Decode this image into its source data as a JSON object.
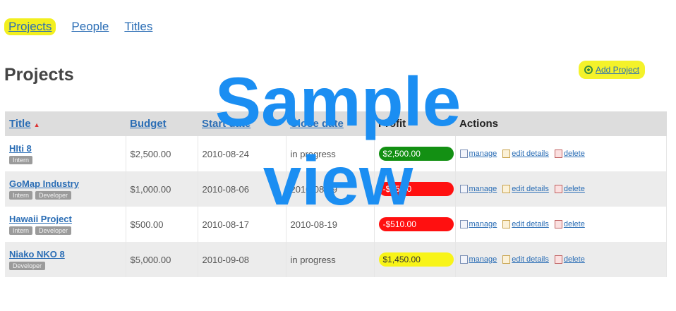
{
  "nav": {
    "items": [
      "Projects",
      "People",
      "Titles"
    ]
  },
  "page": {
    "title": "Projects",
    "add_label": "Add Project"
  },
  "table": {
    "headers": {
      "title": "Title",
      "budget": "Budget",
      "start": "Start date",
      "close": "Close date",
      "profit": "Profit",
      "actions": "Actions"
    },
    "rows": [
      {
        "title": "HIti 8",
        "tags": [
          "Intern"
        ],
        "budget": "$2,500.00",
        "start": "2010-08-24",
        "close": "in progress",
        "profit": "$2,500.00",
        "profit_color": "#139013"
      },
      {
        "title": "GoMap Industry",
        "tags": [
          "Intern",
          "Developer"
        ],
        "budget": "$1,000.00",
        "start": "2010-08-06",
        "close": "2010-08-09",
        "profit": "-$75.00",
        "profit_color": "#ff1010"
      },
      {
        "title": "Hawaii Project",
        "tags": [
          "Intern",
          "Developer"
        ],
        "budget": "$500.00",
        "start": "2010-08-17",
        "close": "2010-08-19",
        "profit": "-$510.00",
        "profit_color": "#ff1010"
      },
      {
        "title": "Niako NKO 8",
        "tags": [
          "Developer"
        ],
        "budget": "$5,000.00",
        "start": "2010-09-08",
        "close": "in progress",
        "profit": "$1,450.00",
        "profit_color": "#f8f418"
      }
    ],
    "actions": {
      "manage": "manage",
      "edit": "edit details",
      "delete": "delete"
    }
  },
  "watermark": {
    "line1": "Sample",
    "line2": "view"
  }
}
